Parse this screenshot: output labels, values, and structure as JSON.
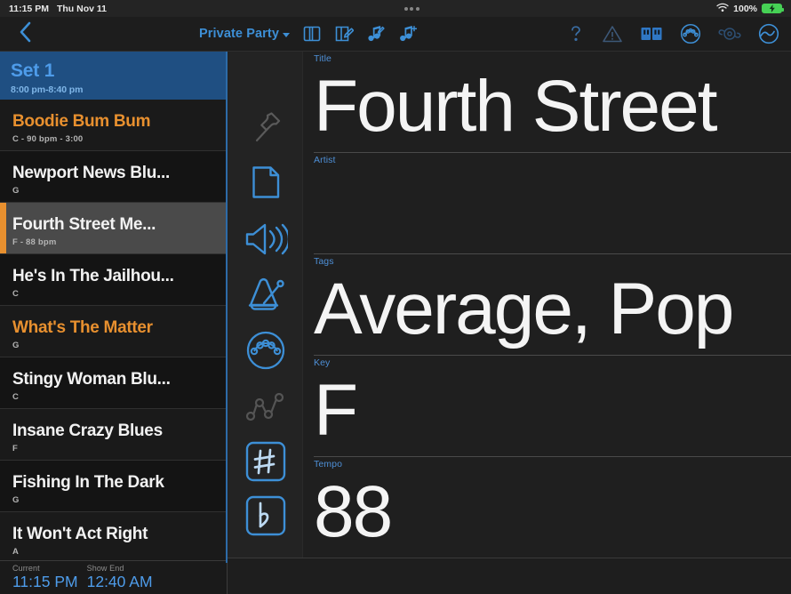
{
  "status_bar": {
    "time": "11:15 PM",
    "date": "Thu Nov 11",
    "battery_percent": "100%",
    "wifi_icon": "wifi-icon",
    "battery_icon": "battery-charging-icon",
    "multitask_handle": "multitask-dots-handle"
  },
  "toolbar": {
    "back_icon": "chevron-left-icon",
    "title": "Private Party",
    "title_caret_icon": "chevron-down-icon",
    "center_icons": [
      {
        "name": "layout-panel-icon"
      },
      {
        "name": "edit-layout-icon"
      },
      {
        "name": "edit-song-icon"
      },
      {
        "name": "add-song-icon"
      }
    ],
    "right_icons": [
      {
        "name": "help-icon"
      },
      {
        "name": "warning-icon"
      },
      {
        "name": "library-icon"
      },
      {
        "name": "drum-pad-icon"
      },
      {
        "name": "audio-device-icon"
      },
      {
        "name": "sync-icon"
      }
    ]
  },
  "sidebar": {
    "set_header": {
      "title": "Set 1",
      "range": "8:00 pm-8:40 pm"
    },
    "songs": [
      {
        "name": "Boodie Bum Bum",
        "meta": "C - 90 bpm - 3:00",
        "accent": true,
        "selected": false
      },
      {
        "name": "Newport News Blu...",
        "meta": "G",
        "accent": false,
        "selected": false
      },
      {
        "name": "Fourth Street Me...",
        "meta": "F - 88 bpm",
        "accent": false,
        "selected": true
      },
      {
        "name": "He's In The Jailhou...",
        "meta": "C",
        "accent": false,
        "selected": false
      },
      {
        "name": "What's The Matter",
        "meta": "G",
        "accent": true,
        "selected": false
      },
      {
        "name": "Stingy Woman Blu...",
        "meta": "C",
        "accent": false,
        "selected": false
      },
      {
        "name": "Insane Crazy Blues",
        "meta": "F",
        "accent": false,
        "selected": false
      },
      {
        "name": "Fishing In The Dark",
        "meta": "G",
        "accent": false,
        "selected": false
      },
      {
        "name": "It Won't Act Right",
        "meta": "A",
        "accent": false,
        "selected": false
      }
    ]
  },
  "time_bar": {
    "current_label": "Current",
    "current_value": "11:15 PM",
    "show_end_label": "Show End",
    "show_end_value": "12:40 AM"
  },
  "detail": {
    "rail_icons": [
      {
        "name": "pin-icon",
        "active": false
      },
      {
        "name": "document-icon",
        "active": true
      },
      {
        "name": "volume-icon",
        "active": true
      },
      {
        "name": "metronome-icon",
        "active": true
      },
      {
        "name": "drum-pad-icon",
        "active": true
      },
      {
        "name": "automation-icon",
        "active": false
      },
      {
        "name": "sharp-icon",
        "active": true
      },
      {
        "name": "flat-icon",
        "active": true
      }
    ],
    "fields": [
      {
        "label": "Title",
        "value": "Fourth Street"
      },
      {
        "label": "Artist",
        "value": ""
      },
      {
        "label": "Tags",
        "value": "Average, Pop"
      },
      {
        "label": "Key",
        "value": "F"
      },
      {
        "label": "Tempo",
        "value": "88"
      }
    ]
  },
  "colors": {
    "accent_blue": "#4e9cea",
    "accent_orange": "#e8902f",
    "selected_row_bg": "#4a4a4a",
    "set_header_bg": "#1f4f82",
    "battery_green": "#46d155"
  }
}
